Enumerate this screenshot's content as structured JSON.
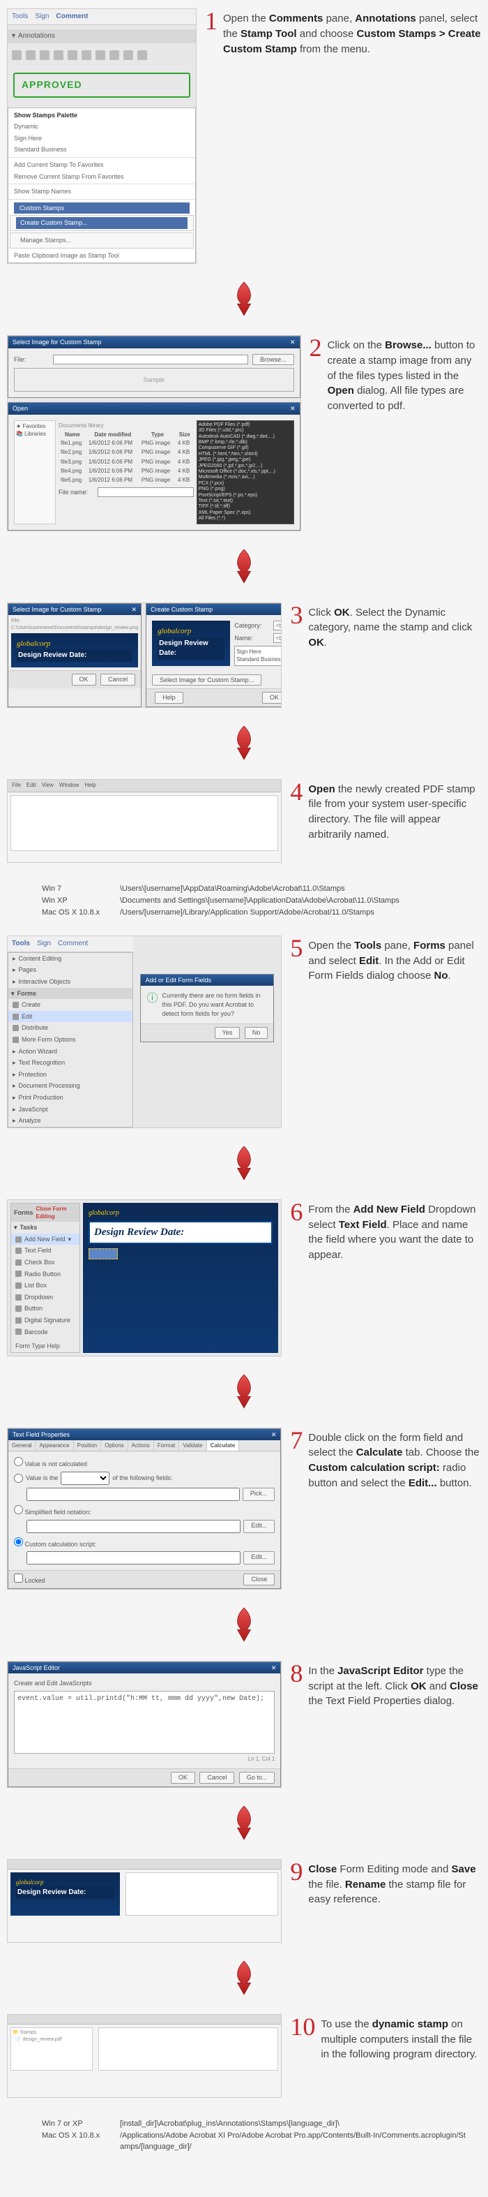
{
  "steps": [
    {
      "num": "1",
      "html": "Open the <b>Comments</b> pane, <b>Annotations</b> panel, select the <b>Stamp Tool</b> and choose <b>Custom Stamps > Create Custom Stamp</b> from the menu."
    },
    {
      "num": "2",
      "html": "Click on the <b>Browse...</b> button to create a stamp image from any of the files types listed in the <b>Open</b> dialog. All file types are converted to pdf."
    },
    {
      "num": "3",
      "html": "Click <b>OK</b>. Select the Dynamic category, name the stamp and click <b>OK</b>."
    },
    {
      "num": "4",
      "html": "<b>Open</b> the newly created PDF stamp file from your system user-specific directory. The file will appear arbitrarily named."
    },
    {
      "num": "5",
      "html": "Open the <b>Tools</b> pane, <b>Forms</b> panel and select <b>Edit</b>. In the Add or Edit Form Fields dialog choose <b>No</b>."
    },
    {
      "num": "6",
      "html": "From the <b>Add New Field</b> Dropdown select <b>Text Field</b>. Place and name the field where you want the date to appear."
    },
    {
      "num": "7",
      "html": "Double click on the form field and select the <b>Calculate</b> tab. Choose the <b>Custom calculation script:</b> radio button and select the <b>Edit...</b> button."
    },
    {
      "num": "8",
      "html": "In the <b>JavaScript Editor</b> type the script at the left. Click <b>OK</b> and <b>Close</b> the Text Field Properties dialog."
    },
    {
      "num": "9",
      "html": "<b>Close</b> Form Editing mode and <b>Save</b> the file. <b>Rename</b> the stamp file for easy reference."
    },
    {
      "num": "10",
      "html": "To use the <b>dynamic stamp</b> on multiple computers install the file in the following program directory."
    }
  ],
  "fig1": {
    "tabs": [
      "Tools",
      "Sign",
      "Comment"
    ],
    "panel_title": "Annotations",
    "stamp_text": "APPROVED",
    "menu": {
      "head": "Show Stamps Palette",
      "items": [
        "Dynamic",
        "Sign Here",
        "Standard Business"
      ],
      "items2": [
        "Add Current Stamp To Favorites",
        "Remove Current Stamp From Favorites"
      ],
      "items3": [
        "Show Stamp Names"
      ],
      "custom_head": "Custom Stamps",
      "custom_sub": [
        "Create Custom Stamp...",
        "Manage Stamps..."
      ],
      "paste": "Paste Clipboard Image as Stamp Tool"
    }
  },
  "fig2": {
    "title": "Select Image for Custom Stamp",
    "file_label": "File:",
    "browse": "Browse...",
    "sample": "Sample",
    "open_title": "Open",
    "lib": "Documents library",
    "cols": [
      "Name",
      "Date modified",
      "Type",
      "Size"
    ],
    "files": [
      [
        "file1.png",
        "1/6/2012 6:06 PM",
        "PNG image",
        "4 KB"
      ],
      [
        "file2.png",
        "1/6/2012 6:06 PM",
        "PNG image",
        "4 KB"
      ],
      [
        "file3.png",
        "1/6/2012 6:06 PM",
        "PNG image",
        "4 KB"
      ],
      [
        "file4.png",
        "1/6/2012 6:06 PM",
        "PNG image",
        "4 KB"
      ],
      [
        "file5.png",
        "1/6/2012 6:06 PM",
        "PNG image",
        "4 KB"
      ]
    ],
    "filetypes": [
      "Adobe PDF Files (*.pdf)",
      "3D Files (*.u3d,*.prc)",
      "Autodesk AutoCAD (*.dwg,*.dwt,...)",
      "BMP (*.bmp,*.rle,*.dib)",
      "Compuserve GIF (*.gif)",
      "HTML (*.html,*.htm,*.shtml)",
      "JPEG (*.jpg,*.jpeg,*.jpe)",
      "JPEG2000 (*.jpf,*.jpx,*.jp2,...)",
      "Microsoft Office (*.doc,*.xls,*.ppt,...)",
      "Multimedia (*.mov,*.avi,...)",
      "PCX (*.pcx)",
      "PNG (*.png)",
      "PostScript/EPS (*.ps,*.eps)",
      "Text (*.txt,*.text)",
      "TIFF (*.tif,*.tiff)",
      "XML Paper Spec (*.xps)",
      "All Files (*.*)"
    ],
    "filename_label": "File name:"
  },
  "fig3": {
    "left_title": "Select Image for Custom Stamp",
    "brand": "globalcorp",
    "brand_label": "Design Review Date:",
    "ok": "OK",
    "cancel": "Cancel",
    "right_title": "Create Custom Stamp",
    "category_label": "Category:",
    "category_ph": "<type here to name a new category>",
    "name_label": "Name:",
    "name_ph": "<type here to name a new category>",
    "options": [
      "Sign Here",
      "Standard Business"
    ],
    "select_btn": "Select Image for Custom Stamp...",
    "help": "Help"
  },
  "paths1": {
    "rows": [
      {
        "os": "Win 7",
        "p": "\\Users\\[username]\\AppData\\Roaming\\Adobe\\Acrobat\\11.0\\Stamps"
      },
      {
        "os": "Win XP",
        "p": "\\Documents and Settings\\[username]\\ApplicationData\\Adobe\\Acrobat\\11.0\\Stamps"
      },
      {
        "os": "Mac OS X 10.8.x",
        "p": "/Users/[username]/Library/Application Support/Adobe/Acrobat/11.0/Stamps"
      }
    ]
  },
  "fig5": {
    "tabs": [
      "Tools",
      "Sign",
      "Comment"
    ],
    "sections": [
      "Content Editing",
      "Pages",
      "Interactive Objects"
    ],
    "forms": "Forms",
    "items": [
      "Create",
      "Edit",
      "Distribute",
      "More Form Options"
    ],
    "after": [
      "Action Wizard",
      "Text Recognition",
      "Protection",
      "Document Processing",
      "Print Production",
      "JavaScript",
      "Analyze"
    ],
    "dlg_title": "Add or Edit Form Fields",
    "dlg_msg": "Currently there are no form fields in this PDF. Do you want Acrobat to detect form fields for you?",
    "yes": "Yes",
    "no": "No"
  },
  "fig6": {
    "forms": "Forms",
    "tasks": "Tasks",
    "close": "Close Form Editing",
    "add": "Add New Field",
    "items": [
      "Text Field",
      "Check Box",
      "Radio Button",
      "List Box",
      "Dropdown",
      "Button",
      "Digital Signature",
      "Barcode"
    ],
    "help": "Form Type Help",
    "banner": "Design Review Date:"
  },
  "fig7": {
    "title": "Text Field Properties",
    "tabs": [
      "General",
      "Appearance",
      "Position",
      "Options",
      "Actions",
      "Format",
      "Validate",
      "Calculate"
    ],
    "r1": "Value is not calculated",
    "r2_pre": "Value is the",
    "r2_post": "of the following fields:",
    "pick": "Pick...",
    "r3": "Simplified field notation:",
    "r4": "Custom calculation script:",
    "edit": "Edit...",
    "locked": "Locked",
    "close": "Close"
  },
  "fig8": {
    "title": "JavaScript Editor",
    "head": "Create and Edit JavaScripts",
    "code": "event.value = util.printd(\"h:MM tt, mmm dd yyyy\",new Date);",
    "pos": "Ln 1, Col 1",
    "ok": "OK",
    "cancel": "Cancel",
    "goto": "Go to..."
  },
  "paths2": {
    "rows": [
      {
        "os": "Win 7 or XP",
        "p": "[install_dir]\\Acrobat\\plug_ins\\Annotations\\Stamps\\[language_dir]\\"
      },
      {
        "os": "Mac OS X 10.8.x",
        "p": "/Applications/Adobe Acrobat XI Pro/Adobe Acrobat Pro.app/Contents/Built-In/Comments.acroplugin/Stamps/[language_dir]/"
      }
    ]
  }
}
